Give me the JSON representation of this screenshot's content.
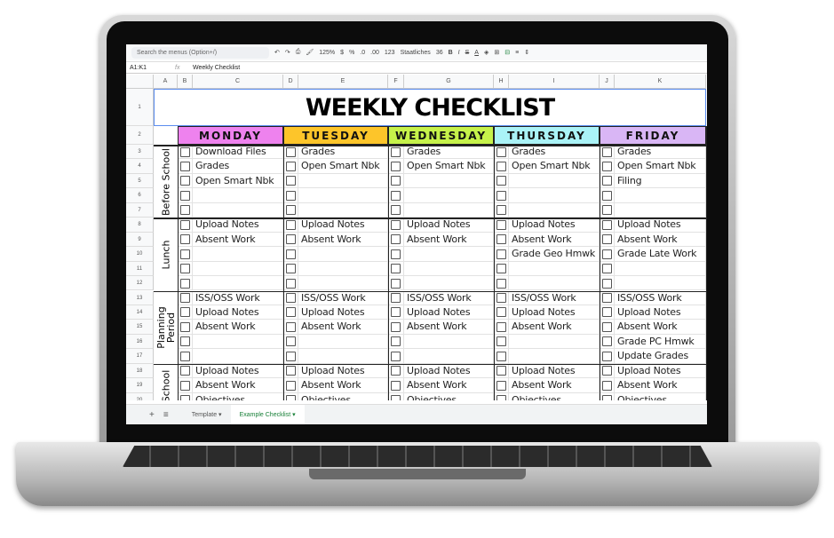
{
  "toolbar": {
    "search_placeholder": "Search the menus (Option+/)",
    "zoom": "125%",
    "currency": "$",
    "percent": "%",
    "decimal_decrease": ".0",
    "decimal_increase": ".00",
    "format_more": "123",
    "font": "Staatliches",
    "font_size": "36",
    "bold": "B",
    "italic": "I",
    "strike": "S",
    "text_color": "A"
  },
  "formula_bar": {
    "range": "A1:K1",
    "fx": "fx",
    "value": "Weekly Checklist"
  },
  "columns": [
    "A",
    "B",
    "C",
    "D",
    "E",
    "F",
    "G",
    "H",
    "I",
    "J",
    "K"
  ],
  "title": "WEEKLY CHECKLIST",
  "days": [
    {
      "name": "MONDAY",
      "color": "#ee82ee"
    },
    {
      "name": "TUESDAY",
      "color": "#fdc52a"
    },
    {
      "name": "WEDNESDAY",
      "color": "#c6f24a"
    },
    {
      "name": "THURSDAY",
      "color": "#aaf3f7"
    },
    {
      "name": "FRIDAY",
      "color": "#d9b6f5"
    }
  ],
  "sections": [
    {
      "label": "Before School",
      "rows": [
        3,
        7
      ]
    },
    {
      "label": "Lunch",
      "rows": [
        8,
        12
      ]
    },
    {
      "label": "Planning Period",
      "rows": [
        13,
        17
      ]
    },
    {
      "label": "School",
      "rows": [
        18,
        20
      ]
    }
  ],
  "rows": [
    {
      "n": 1
    },
    {
      "n": 2
    },
    {
      "n": 3,
      "tasks": [
        "Download Files",
        "Grades",
        "Grades",
        "Grades",
        "Grades"
      ]
    },
    {
      "n": 4,
      "tasks": [
        "Grades",
        "Open Smart Nbk",
        "Open Smart Nbk",
        "Open Smart Nbk",
        "Open Smart Nbk"
      ]
    },
    {
      "n": 5,
      "tasks": [
        "Open Smart Nbk",
        "",
        "",
        "",
        "Filing"
      ]
    },
    {
      "n": 6,
      "tasks": [
        "",
        "",
        "",
        "",
        ""
      ]
    },
    {
      "n": 7,
      "tasks": [
        "",
        "",
        "",
        "",
        ""
      ]
    },
    {
      "n": 8,
      "tasks": [
        "Upload Notes",
        "Upload Notes",
        "Upload Notes",
        "Upload Notes",
        "Upload Notes"
      ]
    },
    {
      "n": 9,
      "tasks": [
        "Absent Work",
        "Absent Work",
        "Absent Work",
        "Absent Work",
        "Absent Work"
      ]
    },
    {
      "n": 10,
      "tasks": [
        "",
        "",
        "",
        "Grade Geo Hmwk",
        "Grade Late Work"
      ]
    },
    {
      "n": 11,
      "tasks": [
        "",
        "",
        "",
        "",
        ""
      ]
    },
    {
      "n": 12,
      "tasks": [
        "",
        "",
        "",
        "",
        ""
      ]
    },
    {
      "n": 13,
      "tasks": [
        "ISS/OSS Work",
        "ISS/OSS Work",
        "ISS/OSS Work",
        "ISS/OSS Work",
        "ISS/OSS Work"
      ]
    },
    {
      "n": 14,
      "tasks": [
        "Upload Notes",
        "Upload Notes",
        "Upload Notes",
        "Upload Notes",
        "Upload Notes"
      ]
    },
    {
      "n": 15,
      "tasks": [
        "Absent Work",
        "Absent Work",
        "Absent Work",
        "Absent Work",
        "Absent Work"
      ]
    },
    {
      "n": 16,
      "tasks": [
        "",
        "",
        "",
        "",
        "Grade PC Hmwk"
      ]
    },
    {
      "n": 17,
      "tasks": [
        "",
        "",
        "",
        "",
        "Update Grades"
      ]
    },
    {
      "n": 18,
      "tasks": [
        "Upload Notes",
        "Upload Notes",
        "Upload Notes",
        "Upload Notes",
        "Upload Notes"
      ]
    },
    {
      "n": 19,
      "tasks": [
        "Absent Work",
        "Absent Work",
        "Absent Work",
        "Absent Work",
        "Absent Work"
      ]
    },
    {
      "n": 20,
      "tasks": [
        "Objectives",
        "Objectives",
        "Objectives",
        "Objectives",
        "Objectives"
      ]
    }
  ],
  "sheet_tabs": {
    "add": "+",
    "list": "≡",
    "tabs": [
      {
        "label": "Template ▾",
        "active": false
      },
      {
        "label": "Example Checklist ▾",
        "active": true
      }
    ]
  }
}
